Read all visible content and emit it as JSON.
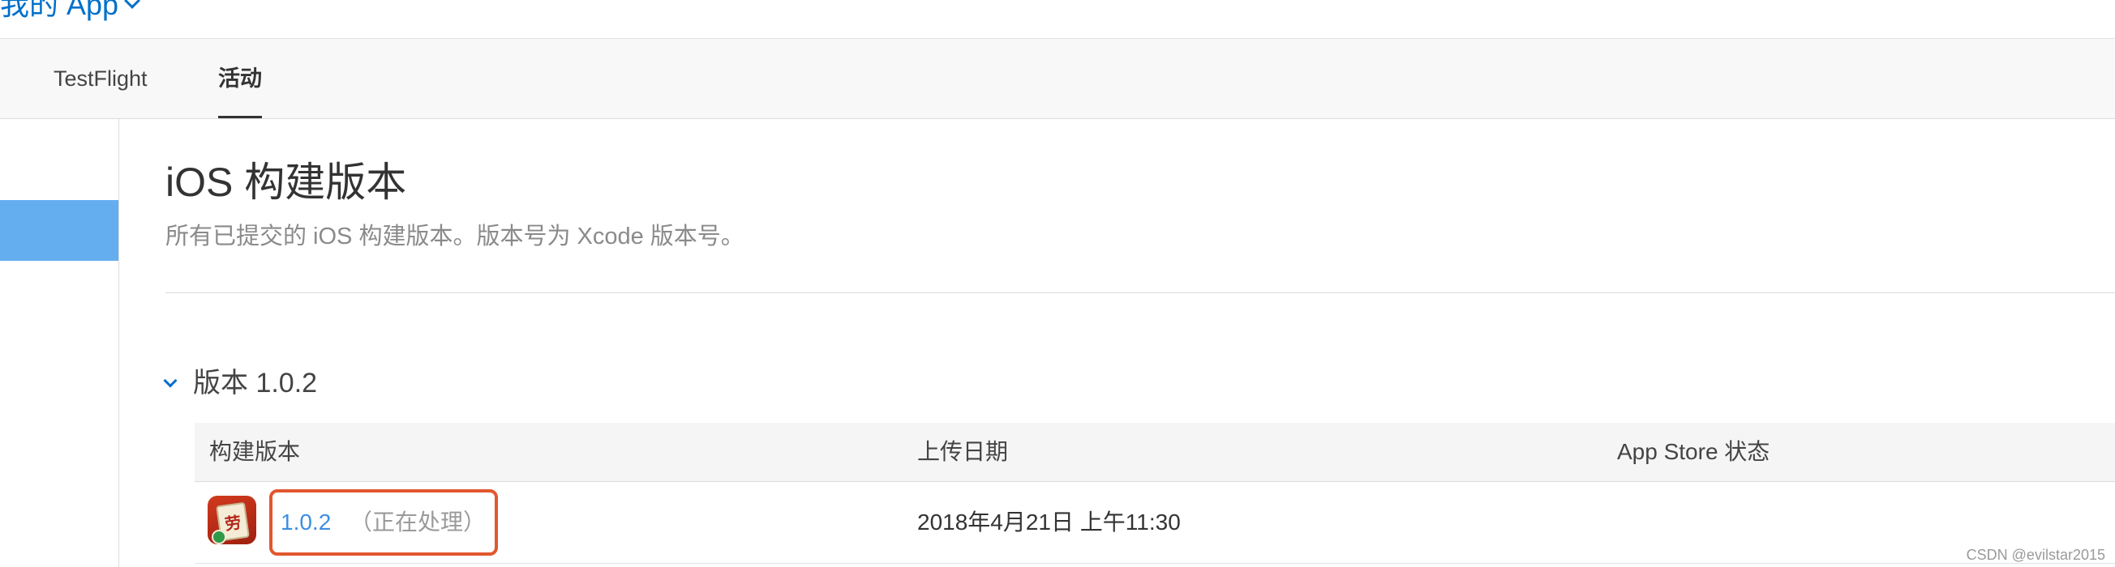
{
  "header": {
    "my_apps_label": "我的 App"
  },
  "tabs": [
    {
      "label": "TestFlight",
      "active": false
    },
    {
      "label": "活动",
      "active": true
    }
  ],
  "main": {
    "title": "iOS 构建版本",
    "subtitle": "所有已提交的 iOS 构建版本。版本号为 Xcode 版本号。",
    "version_group": {
      "label": "版本 1.0.2",
      "expanded": true
    },
    "table": {
      "columns": [
        "构建版本",
        "上传日期",
        "App Store 状态"
      ],
      "rows": [
        {
          "build": "1.0.2",
          "status_note": "（正在处理）",
          "upload_date": "2018年4月21日 上午11:30",
          "app_store_status": ""
        }
      ]
    }
  },
  "icons": {
    "app_icon_char": "劳"
  },
  "colors": {
    "link_blue": "#0070c9",
    "sidebar_active": "#64aef0",
    "highlight_border": "#e2572e"
  },
  "watermark": "CSDN @evilstar2015"
}
